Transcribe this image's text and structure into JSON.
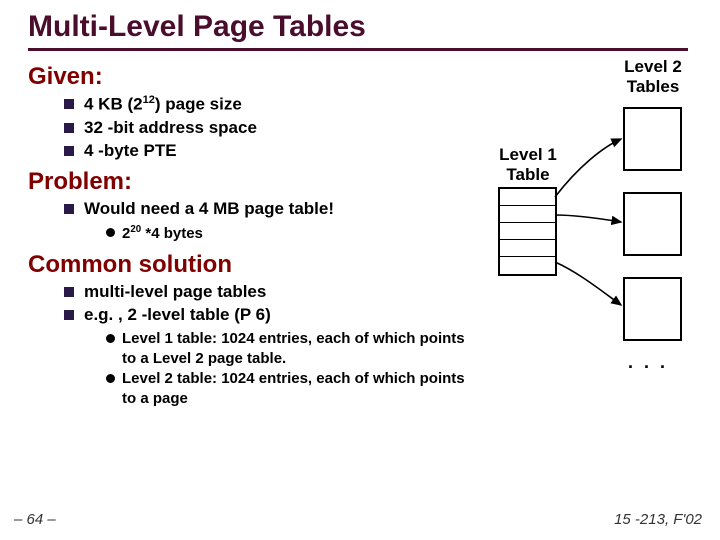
{
  "title": "Multi-Level Page Tables",
  "given": {
    "heading": "Given:",
    "items": [
      {
        "pre": "4 KB (2",
        "sup": "12",
        "post": ") page size"
      },
      {
        "pre": "32 -bit address space",
        "sup": "",
        "post": ""
      },
      {
        "pre": "4 -byte PTE",
        "sup": "",
        "post": ""
      }
    ]
  },
  "problem": {
    "heading": "Problem:",
    "items": [
      {
        "text": "Would need a 4 MB page table!",
        "sub": [
          {
            "pre": "2",
            "sup": "20",
            "post": " *4 bytes"
          }
        ]
      }
    ]
  },
  "solution": {
    "heading": "Common solution",
    "items": [
      {
        "text": "multi-level page tables",
        "sub": []
      },
      {
        "text": "e.g. , 2 -level table (P 6)",
        "sub": [
          {
            "pre": "Level 1 table: 1024 entries, each of which points to a Level 2 page table.",
            "sup": "",
            "post": ""
          },
          {
            "pre": "Level 2 table:  1024 entries, each of which points to a page",
            "sup": "",
            "post": ""
          }
        ]
      }
    ]
  },
  "diagram": {
    "level2_title_1": "Level 2",
    "level2_title_2": "Tables",
    "level1_title_1": "Level 1",
    "level1_title_2": "Table",
    "dots": ". . ."
  },
  "footer": {
    "left": "– 64 –",
    "right": "15 -213, F'02"
  }
}
